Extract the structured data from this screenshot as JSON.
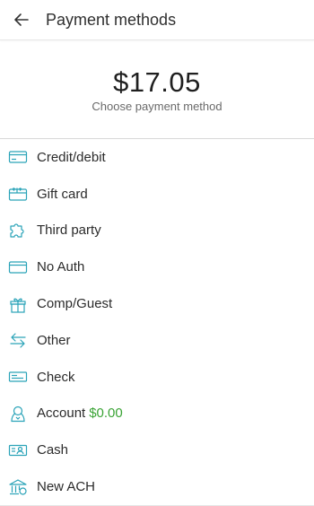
{
  "header": {
    "title": "Payment methods",
    "back_icon": "arrow-left-icon"
  },
  "summary": {
    "amount": "$17.05",
    "subtitle": "Choose payment method"
  },
  "colors": {
    "icon": "#2aa3b8",
    "positive": "#3aa335"
  },
  "methods": [
    {
      "label": "Credit/debit",
      "icon": "credit-card-icon"
    },
    {
      "label": "Gift card",
      "icon": "gift-card-icon"
    },
    {
      "label": "Third party",
      "icon": "puzzle-icon"
    },
    {
      "label": "No Auth",
      "icon": "card-icon"
    },
    {
      "label": "Comp/Guest",
      "icon": "gift-box-icon"
    },
    {
      "label": "Other",
      "icon": "swap-arrows-icon"
    },
    {
      "label": "Check",
      "icon": "check-icon"
    },
    {
      "label": "Account",
      "icon": "user-account-icon",
      "value": "$0.00"
    },
    {
      "label": "Cash",
      "icon": "cash-icon"
    },
    {
      "label": "New ACH",
      "icon": "bank-icon"
    }
  ]
}
